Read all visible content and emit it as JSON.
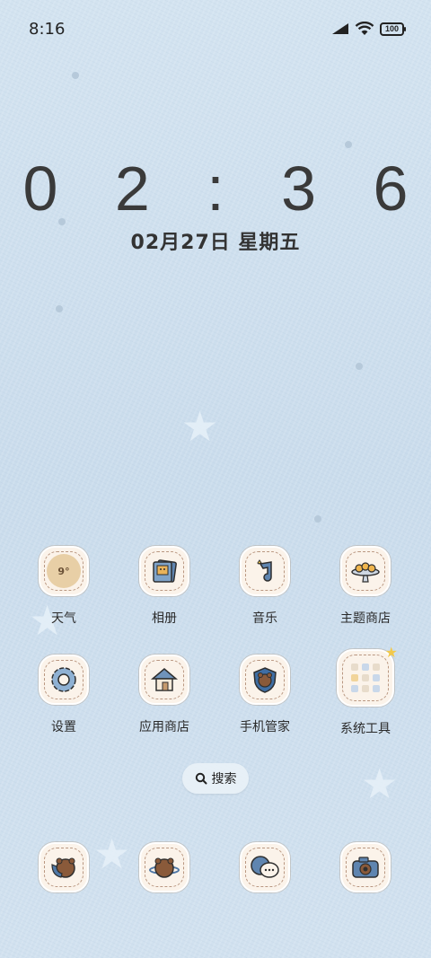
{
  "status": {
    "time": "8:16",
    "battery": "100"
  },
  "clock": {
    "time": "0 2 : 3 6",
    "date": "02月27日 星期五"
  },
  "apps": [
    {
      "label": "天气",
      "icon": "weather-icon",
      "badge": "9°"
    },
    {
      "label": "相册",
      "icon": "photo-album-icon"
    },
    {
      "label": "音乐",
      "icon": "music-note-icon"
    },
    {
      "label": "主题商店",
      "icon": "cake-stand-icon"
    },
    {
      "label": "设置",
      "icon": "gear-icon"
    },
    {
      "label": "应用商店",
      "icon": "house-icon"
    },
    {
      "label": "手机管家",
      "icon": "shield-bear-icon"
    },
    {
      "label": "系统工具",
      "icon": "folder-icon"
    }
  ],
  "search": {
    "label": "搜索"
  },
  "dock": [
    {
      "icon": "phone-bear-icon"
    },
    {
      "icon": "planet-bear-icon"
    },
    {
      "icon": "message-bubbles-icon"
    },
    {
      "icon": "camera-icon"
    }
  ]
}
